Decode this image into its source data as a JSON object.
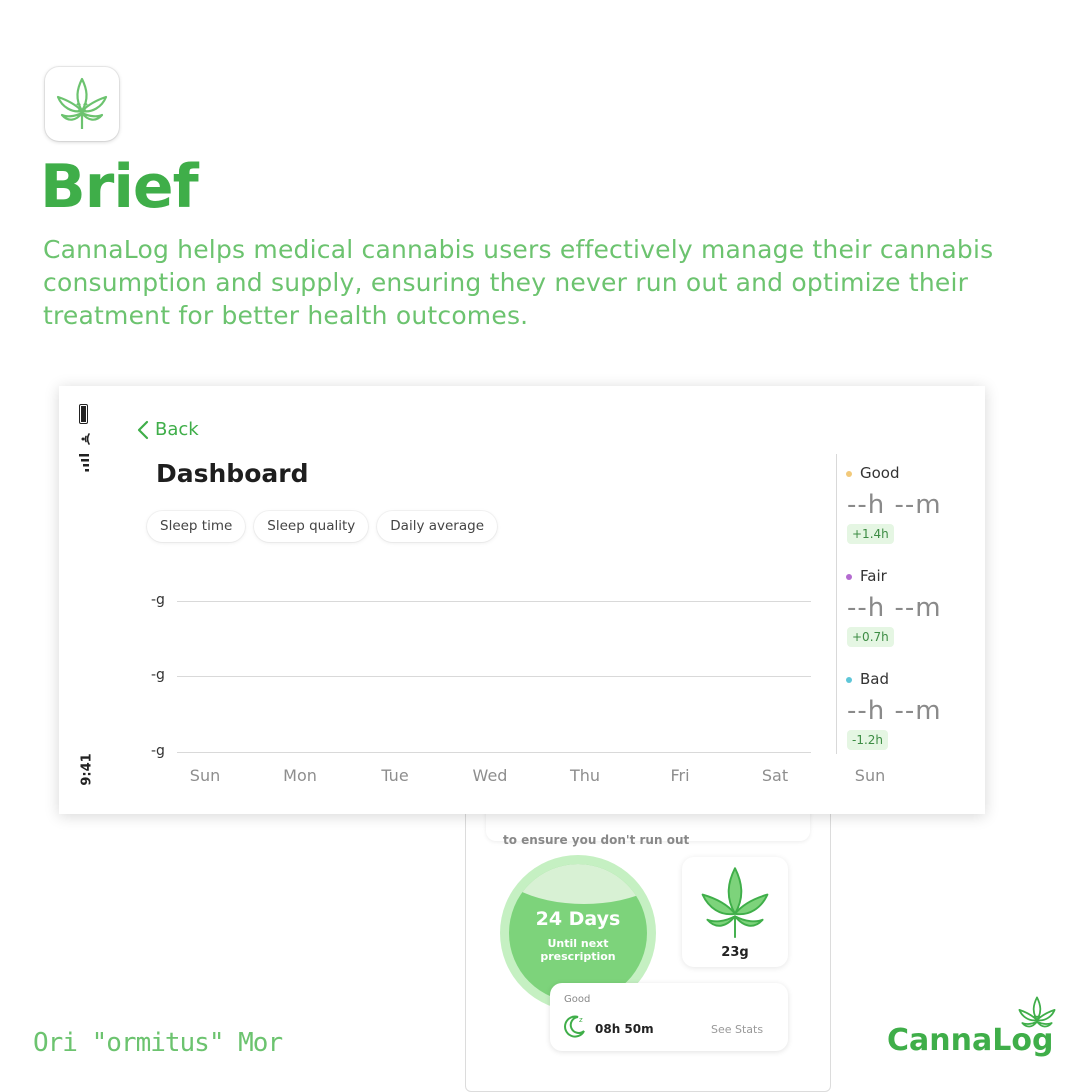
{
  "brief": {
    "title": "Brief",
    "description": "CannaLog helps medical cannabis users effectively manage their cannabis consumption and supply, ensuring they never run out and optimize their treatment for better health outcomes."
  },
  "status_bar": {
    "time": "9:41"
  },
  "dashboard": {
    "back_label": "Back",
    "title": "Dashboard",
    "tabs": [
      "Sleep time",
      "Sleep quality",
      "Daily average"
    ],
    "chart_data": {
      "type": "line",
      "y_tick_labels": [
        "-g",
        "-g",
        "-g"
      ],
      "categories": [
        "Sun",
        "Mon",
        "Tue",
        "Wed",
        "Thu",
        "Fri",
        "Sat",
        "Sun"
      ],
      "series": []
    },
    "legend": [
      {
        "name": "Good",
        "duration": "--h --m",
        "change": "+1.4h",
        "color": "#f2c97a"
      },
      {
        "name": "Fair",
        "duration": "--h --m",
        "change": "+0.7h",
        "color": "#b46bd0"
      },
      {
        "name": "Bad",
        "duration": "--h --m",
        "change": "-1.2h",
        "color": "#5ec6d8"
      }
    ]
  },
  "phone": {
    "notice_text": "to ensure you don't run out",
    "prescription": {
      "days": "24 Days",
      "label_line1": "Until next",
      "label_line2": "prescription"
    },
    "stock": {
      "amount": "23g"
    },
    "sleep": {
      "quality": "Good",
      "duration": "08h 50m",
      "link": "See Stats"
    }
  },
  "footer": {
    "author": "Ori \"ormitus\" Mor",
    "brand": "CannaLog"
  },
  "colors": {
    "brand_green": "#3fae49",
    "light_green": "#6cc36f"
  }
}
